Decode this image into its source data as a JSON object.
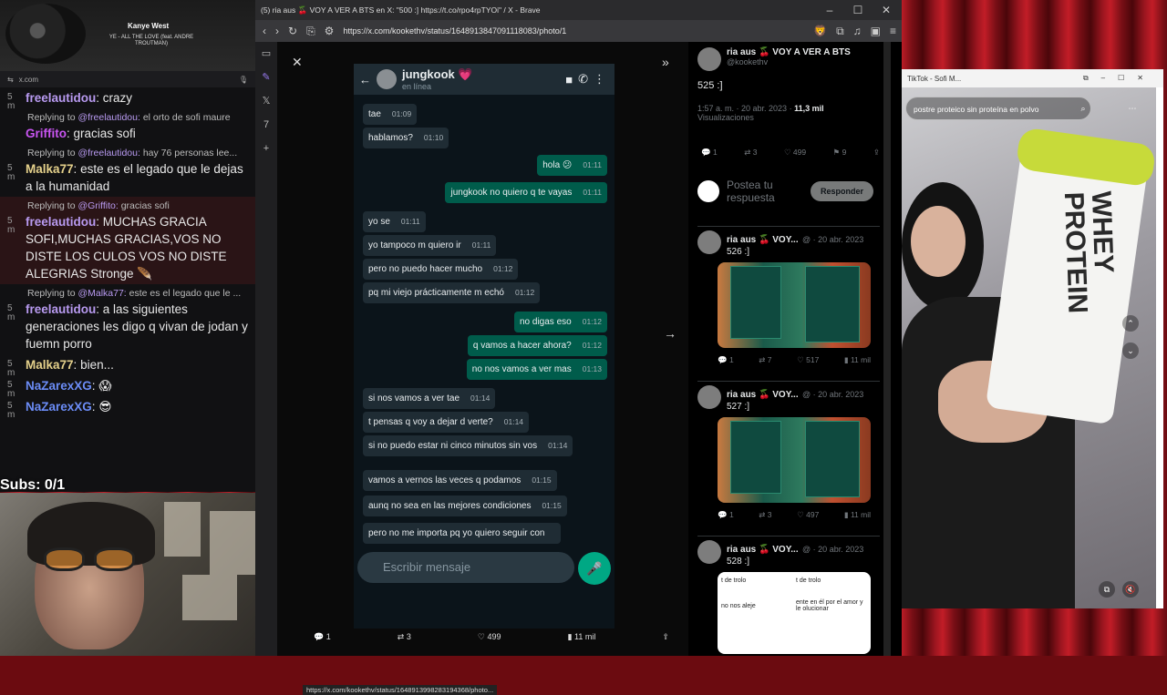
{
  "now_playing": {
    "artist": "Kanye West",
    "song": "YE - ALL THE LOVE (feat. ANDRE TROUTMAN)"
  },
  "chat": {
    "url": "x.com",
    "messages": [
      {
        "time": "5 m",
        "user": "freelautidou",
        "user_color": "#b89af0",
        "text": "crazy"
      },
      {
        "reply_to": "@freelautidou:",
        "reply_text": "el orto de sofi maure",
        "time": "",
        "user": "Griffito",
        "user_color": "#c955f2",
        "text": "gracias sofi"
      },
      {
        "reply_to": "@freelautidou:",
        "reply_text": "hay 76 personas lee...",
        "time": "5 m",
        "user": "Malka77",
        "user_color": "#e5d18b",
        "text": "este es el legado que le dejas a la humanidad"
      },
      {
        "reply_to": "@Griffito:",
        "reply_text": "gracias sofi",
        "time": "5 m",
        "user": "freelautidou",
        "user_color": "#b89af0",
        "text": "MUCHAS GRACIA SOFI,MUCHAS GRACIAS,VOS NO DISTE LOS CULOS VOS NO DISTE ALEGRIAS Stronge 🪶"
      },
      {
        "reply_to": "@Malka77:",
        "reply_text": "este es el legado que le ...",
        "time": "5 m",
        "user": "freelautidou",
        "user_color": "#b89af0",
        "text": "a las siguientes generaciones les digo q vivan de jodan y fuemn porro"
      },
      {
        "time": "5 m",
        "user": "Malka77",
        "user_color": "#e5d18b",
        "text": "bien..."
      },
      {
        "time": "5 m",
        "user": "NaZarexXG",
        "user_color": "#6b8cf6",
        "text": "😱"
      },
      {
        "time": "5 m",
        "user": "NaZarexXG",
        "user_color": "#6b8cf6",
        "text": "😎"
      }
    ],
    "replying_prefix": "Replying to"
  },
  "subs": "Subs: 0/1",
  "browser": {
    "tab_title": "(5) ria aus 🍒 VOY A VER A BTS en X: \"500 :] https://t.co/rpo4rpTYOi\" / X - Brave",
    "url": "https://x.com/kookethv/status/1648913847091118083/photo/1",
    "status_url": "https://x.com/kookethv/status/1648913998283194368/photo..."
  },
  "whatsapp": {
    "contact": "jungkook 💗",
    "status": "en línea",
    "input_placeholder": "Escribir mensaje",
    "messages": [
      {
        "dir": "in",
        "text": "tae",
        "time": "01:09"
      },
      {
        "dir": "in",
        "text": "hablamos?",
        "time": "01:10"
      },
      {
        "dir": "out",
        "text": "hola 😕",
        "time": "01:11"
      },
      {
        "dir": "out",
        "text": "jungkook no quiero q te vayas",
        "time": "01:11"
      },
      {
        "dir": "in",
        "text": "yo se",
        "time": "01:11"
      },
      {
        "dir": "in",
        "text": "yo tampoco m quiero ir",
        "time": "01:11"
      },
      {
        "dir": "in",
        "text": "pero no puedo hacer mucho",
        "time": "01:12"
      },
      {
        "dir": "in",
        "text": "pq mi viejo prácticamente m echó",
        "time": "01:12"
      },
      {
        "dir": "out",
        "text": "no digas eso",
        "time": "01:12"
      },
      {
        "dir": "out",
        "text": "q vamos a hacer ahora?",
        "time": "01:12"
      },
      {
        "dir": "out",
        "text": "no nos vamos a ver mas",
        "time": "01:13"
      },
      {
        "dir": "in",
        "text": "si nos vamos a ver tae",
        "time": "01:14"
      },
      {
        "dir": "in",
        "text": "t pensas q voy a dejar d verte?",
        "time": "01:14"
      },
      {
        "dir": "in",
        "text": "si no puedo estar ni cinco minutos sin vos",
        "time": "01:14"
      },
      {
        "dir": "in",
        "text": "vamos a vernos las veces q podamos",
        "time": "01:15"
      },
      {
        "dir": "in",
        "text": "aunq no sea en las mejores condiciones",
        "time": "01:15"
      },
      {
        "dir": "in",
        "text": "pero no me importa pq yo quiero seguir con",
        "time": ""
      }
    ]
  },
  "viewer_stats": {
    "replies": "1",
    "reposts": "3",
    "likes": "499",
    "views": "11 mil"
  },
  "tweet": {
    "name": "ria aus 🍒 VOY A VER A BTS",
    "handle": "@kookethv",
    "text": "525 :]",
    "meta": "1:57 a. m. · 20 abr. 2023 · ",
    "views_num": "11,3 mil",
    "views_label": "Visualizaciones",
    "stats": {
      "replies": "1",
      "reposts": "3",
      "likes": "499",
      "bookmarks": "9"
    },
    "reply_placeholder": "Postea tu respuesta",
    "reply_button": "Responder",
    "thread": [
      {
        "name": "ria aus 🍒 VOY...",
        "date": "@ · 20 abr. 2023",
        "text": "526 :]",
        "replies": "1",
        "reposts": "7",
        "likes": "517",
        "views": "11 mil"
      },
      {
        "name": "ria aus 🍒 VOY...",
        "date": "@ · 20 abr. 2023",
        "text": "527 :]",
        "replies": "1",
        "reposts": "3",
        "likes": "497",
        "views": "11 mil"
      },
      {
        "name": "ria aus 🍒 VOY...",
        "date": "@ · 20 abr. 2023",
        "text": "528 :]",
        "cap1": "t de trolo",
        "cap2": "t de trolo",
        "line1": "no nos aleje",
        "line2": "ente en él por el amor y le olucionar"
      }
    ]
  },
  "tiktok": {
    "title": "TikTok - Sofi M...",
    "search": "postre proteico sin proteína en polvo",
    "bag_text": "WHEY PROTEIN"
  }
}
